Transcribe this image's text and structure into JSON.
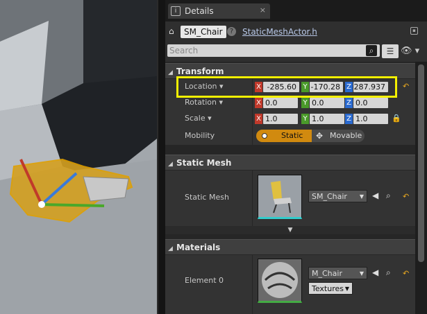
{
  "tab": {
    "title": "Details",
    "close": "×"
  },
  "actor": {
    "name": "SM_Chair",
    "header_file": "StaticMeshActor.h"
  },
  "search": {
    "placeholder": "Search"
  },
  "transform": {
    "title": "Transform",
    "location": {
      "label": "Location",
      "x": "-285.60",
      "y": "-170.28",
      "z": "287.937"
    },
    "rotation": {
      "label": "Rotation",
      "x": "0.0",
      "y": "0.0",
      "z": "0.0"
    },
    "scale": {
      "label": "Scale",
      "x": "1.0",
      "y": "1.0",
      "z": "1.0"
    },
    "mobility": {
      "label": "Mobility",
      "static": "Static",
      "movable": "Movable"
    }
  },
  "axis": {
    "x": "X",
    "y": "Y",
    "z": "Z"
  },
  "static_mesh": {
    "title": "Static Mesh",
    "label": "Static Mesh",
    "value": "SM_Chair"
  },
  "materials": {
    "title": "Materials",
    "element_label": "Element 0",
    "value": "M_Chair",
    "textures": "Textures"
  },
  "colors": {
    "accent_orange": "#d18a0f",
    "highlight_yellow": "#f5f100"
  }
}
